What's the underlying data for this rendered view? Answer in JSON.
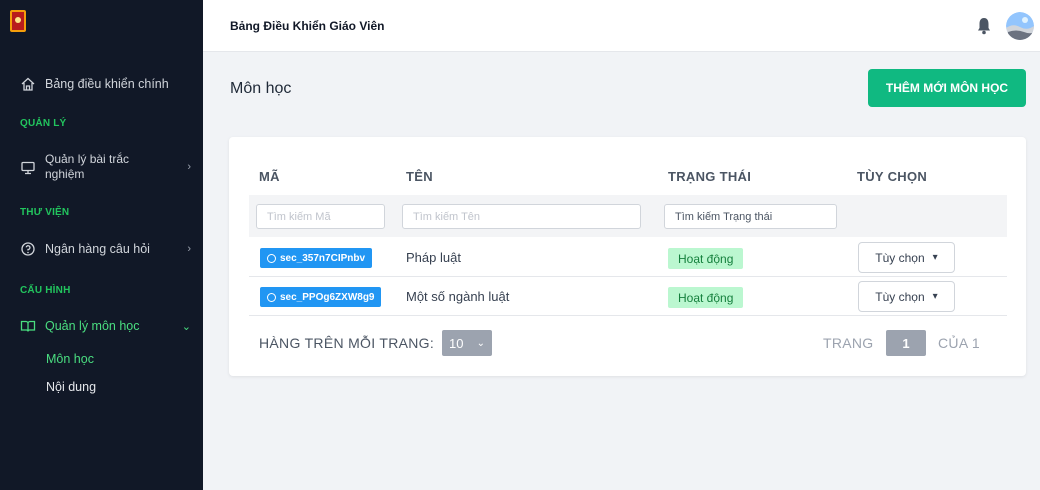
{
  "topbar": {
    "title": "Bảng Điều Khiển Giáo Viên"
  },
  "sidebar": {
    "dashboard": "Bảng điều khiển chính",
    "section_manage": "QUẢN LÝ",
    "quiz_line1": "Quản lý bài trắc",
    "quiz_line2": "nghiệm",
    "section_library": "THƯ VIỆN",
    "question_bank": "Ngân hàng câu hỏi",
    "section_config": "CẤU HÌNH",
    "subject_mgmt": "Quản lý môn học",
    "sub_subject": "Môn học",
    "sub_content": "Nội dung"
  },
  "main": {
    "page_title": "Môn học",
    "add_button": "THÊM MỚI MÔN HỌC"
  },
  "table": {
    "headers": [
      "MÃ",
      "TÊN",
      "TRẠNG THÁI",
      "TÙY CHỌN"
    ],
    "filters": {
      "code_placeholder": "Tìm kiếm Mã",
      "name_placeholder": "Tìm kiếm Tên",
      "status_placeholder": "Tìm kiếm Trạng thái"
    },
    "rows": [
      {
        "code": "sec_357n7CIPnbv",
        "name": "Pháp luật",
        "status": "Hoạt động",
        "option": "Tùy chọn"
      },
      {
        "code": "sec_PPOg6ZXW8g9",
        "name": "Một số ngành luật",
        "status": "Hoạt động",
        "option": "Tùy chọn"
      }
    ]
  },
  "pagination": {
    "rows_per_page_label": "HÀNG TRÊN MỖI TRANG:",
    "rows_per_page": "10",
    "page_label": "TRANG",
    "current_page": "1",
    "of_label": "CỦA 1"
  },
  "colors": {
    "sidebar_bg": "#111827",
    "accent_green": "#10b981",
    "section_green": "#22c55e",
    "code_badge": "#2196f3",
    "status_bg": "#bbf7d0"
  },
  "icons": [
    "home-icon",
    "monitor-icon",
    "help-circle-icon",
    "book-open-icon",
    "bell-icon",
    "chevron-right-icon",
    "chevron-down-icon",
    "clip-icon"
  ]
}
